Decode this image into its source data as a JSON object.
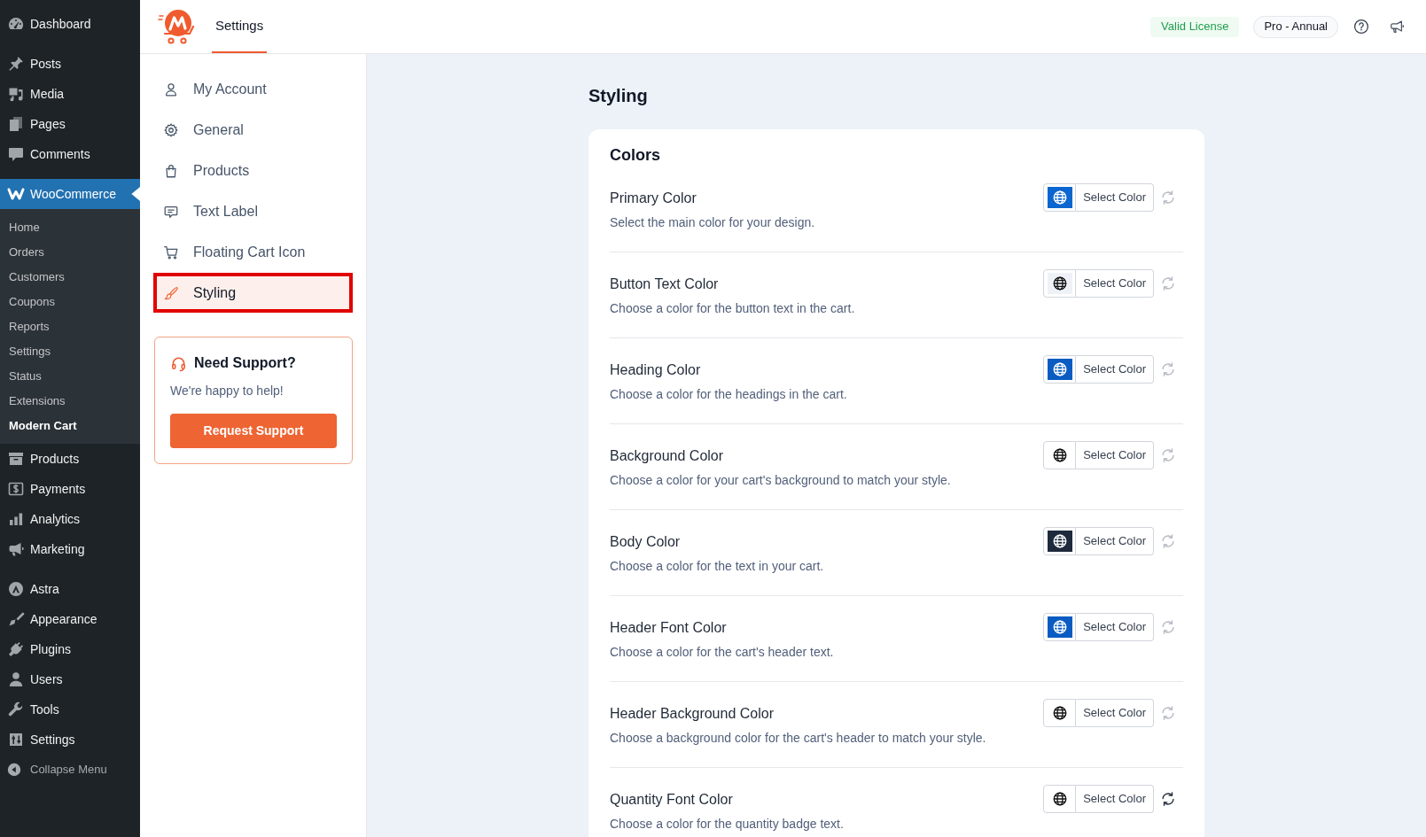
{
  "admin_menu": {
    "sections": [
      {
        "items": [
          {
            "label": "Dashboard",
            "selected": false
          }
        ]
      },
      {
        "items": [
          {
            "label": "Posts",
            "selected": false
          },
          {
            "label": "Media",
            "selected": false
          },
          {
            "label": "Pages",
            "selected": false
          },
          {
            "label": "Comments",
            "selected": false
          }
        ]
      },
      {
        "items": [
          {
            "label": "WooCommerce",
            "selected": true,
            "children": [
              {
                "label": "Home",
                "selected": false
              },
              {
                "label": "Orders",
                "selected": false
              },
              {
                "label": "Customers",
                "selected": false
              },
              {
                "label": "Coupons",
                "selected": false
              },
              {
                "label": "Reports",
                "selected": false
              },
              {
                "label": "Settings",
                "selected": false
              },
              {
                "label": "Status",
                "selected": false
              },
              {
                "label": "Extensions",
                "selected": false
              },
              {
                "label": "Modern Cart",
                "selected": true
              }
            ]
          },
          {
            "label": "Products",
            "selected": false
          },
          {
            "label": "Payments",
            "selected": false
          },
          {
            "label": "Analytics",
            "selected": false
          },
          {
            "label": "Marketing",
            "selected": false
          }
        ]
      },
      {
        "items": [
          {
            "label": "Astra",
            "selected": false
          },
          {
            "label": "Appearance",
            "selected": false
          },
          {
            "label": "Plugins",
            "selected": false
          },
          {
            "label": "Users",
            "selected": false
          },
          {
            "label": "Tools",
            "selected": false
          },
          {
            "label": "Settings",
            "selected": false
          }
        ]
      }
    ],
    "collapse_label": "Collapse Menu"
  },
  "header": {
    "tabs": [
      {
        "label": "Settings",
        "selected": true
      }
    ],
    "license_badge": "Valid License",
    "plan_badge": "Pro - Annual"
  },
  "settings_nav": {
    "items": [
      {
        "label": "My Account",
        "selected": false
      },
      {
        "label": "General",
        "selected": false
      },
      {
        "label": "Products",
        "selected": false
      },
      {
        "label": "Text Label",
        "selected": false
      },
      {
        "label": "Floating Cart Icon",
        "selected": false
      },
      {
        "label": "Styling",
        "selected": true
      }
    ],
    "support": {
      "title": "Need Support?",
      "text": "We're happy to help!",
      "button": "Request Support"
    }
  },
  "content": {
    "title": "Styling",
    "section": {
      "title": "Colors",
      "rows": [
        {
          "title": "Primary Color",
          "description": "Select the main color for your design.",
          "color": "#0b66d0",
          "button_label": "Select Color",
          "reset_enabled": false
        },
        {
          "title": "Button Text Color",
          "description": "Choose a color for the button text in the cart.",
          "color": "#eef2f8",
          "button_label": "Select Color",
          "reset_enabled": false
        },
        {
          "title": "Heading Color",
          "description": "Choose a color for the headings in the cart.",
          "color": "#0b5cc2",
          "button_label": "Select Color",
          "reset_enabled": false
        },
        {
          "title": "Background Color",
          "description": "Choose a color for your cart's background to match your style.",
          "color": "#ffffff",
          "button_label": "Select Color",
          "reset_enabled": false
        },
        {
          "title": "Body Color",
          "description": "Choose a color for the text in your cart.",
          "color": "#1e293b",
          "button_label": "Select Color",
          "reset_enabled": false
        },
        {
          "title": "Header Font Color",
          "description": "Choose a color for the cart's header text.",
          "color": "#0b5cc2",
          "button_label": "Select Color",
          "reset_enabled": false
        },
        {
          "title": "Header Background Color",
          "description": "Choose a background color for the cart's header to match your style.",
          "color": "#ffffff",
          "button_label": "Select Color",
          "reset_enabled": false
        },
        {
          "title": "Quantity Font Color",
          "description": "Choose a color for the quantity badge text.",
          "color": "#ffffff",
          "button_label": "Select Color",
          "reset_enabled": true
        }
      ]
    }
  }
}
